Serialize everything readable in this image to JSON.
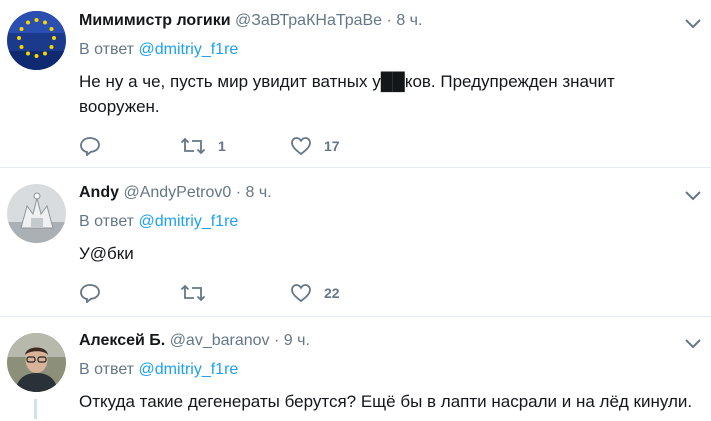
{
  "tweets": [
    {
      "name": "Мимимистр логики",
      "handle": "@ЗаВТраКНаТраВе",
      "dot": "·",
      "time": "8 ч.",
      "reply_prefix": "В ответ",
      "reply_to": "@dmitriy_f1re",
      "text": "Не ну а че, пусть мир увидит ватных у██ков. Предупрежден значит вооружен.",
      "reply_count": "",
      "retweet_count": "1",
      "like_count": "17"
    },
    {
      "name": "Andy",
      "handle": "@AndyPetrov0",
      "dot": "·",
      "time": "8 ч.",
      "reply_prefix": "В ответ",
      "reply_to": "@dmitriy_f1re",
      "text": "У@бки",
      "reply_count": "",
      "retweet_count": "",
      "like_count": "22"
    },
    {
      "name": "Алексей Б.",
      "handle": "@av_baranov",
      "dot": "·",
      "time": "9 ч.",
      "reply_prefix": "В ответ",
      "reply_to": "@dmitriy_f1re",
      "text": "Откуда такие дегенераты берутся? Ещё бы в лапти насрали и на лёд кинули."
    }
  ],
  "colors": {
    "accent": "#1da1f2",
    "muted": "#657786",
    "text": "#14171a",
    "divider": "#e6ecf0"
  },
  "icons": {
    "reply": "reply-icon",
    "retweet": "retweet-icon",
    "like": "heart-icon",
    "more": "chevron-down-icon"
  }
}
